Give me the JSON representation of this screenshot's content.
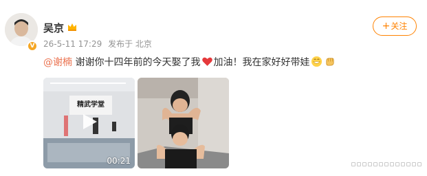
{
  "author": {
    "name": "吴京",
    "avatar_icon": "user-avatar",
    "verified_badge": "V",
    "crown_icon": "crown-icon"
  },
  "post_meta": {
    "time": "26-5-11 17:29",
    "source": "发布于 北京"
  },
  "follow_button": {
    "label": "关注",
    "plus": "+"
  },
  "post": {
    "mention": "@谢楠",
    "text_before_heart": " 谢谢你十四年前的今天娶了我",
    "text_after_heart": "加油！我在家好好带娃",
    "emoji_icons": [
      "heart-icon",
      "grin-emoji-icon",
      "fist-emoji-icon"
    ]
  },
  "media": [
    {
      "type": "video",
      "duration": "00:21",
      "sign_text": "精武学堂"
    },
    {
      "type": "image"
    }
  ],
  "colors": {
    "accent": "#ff8200",
    "mention": "#eb7350",
    "meta": "#939393",
    "heart": "#e5393b"
  }
}
